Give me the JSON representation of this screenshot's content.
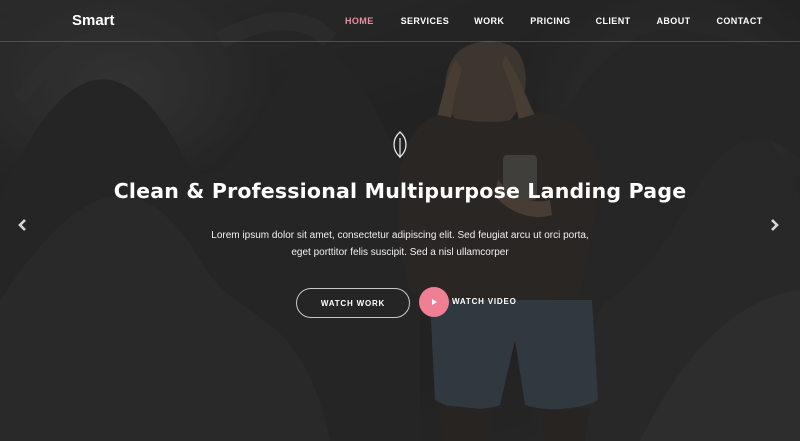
{
  "brand": {
    "name": "Smart"
  },
  "nav": {
    "items": [
      {
        "label": "HOME",
        "active": true
      },
      {
        "label": "SERVICES",
        "active": false
      },
      {
        "label": "WORK",
        "active": false
      },
      {
        "label": "PRICING",
        "active": false
      },
      {
        "label": "CLIENT",
        "active": false
      },
      {
        "label": "ABOUT",
        "active": false
      },
      {
        "label": "CONTACT",
        "active": false
      }
    ],
    "active_color": "#f08ca0"
  },
  "hero": {
    "icon": "leaf-icon",
    "title": "Clean & Professional Multipurpose Landing Page",
    "description_line1": "Lorem ipsum dolor sit amet, consectetur adipiscing elit. Sed feugiat arcu ut orci porta,",
    "description_line2": "eget porttitor felis suscipit. Sed a nisl ullamcorper",
    "watch_work_label": "WATCH WORK",
    "watch_video_label": "WATCH VIDEO",
    "play_icon": "play-icon",
    "accent_color": "#ef8094"
  },
  "carousel": {
    "prev_icon": "chevron-left-icon",
    "next_icon": "chevron-right-icon"
  }
}
